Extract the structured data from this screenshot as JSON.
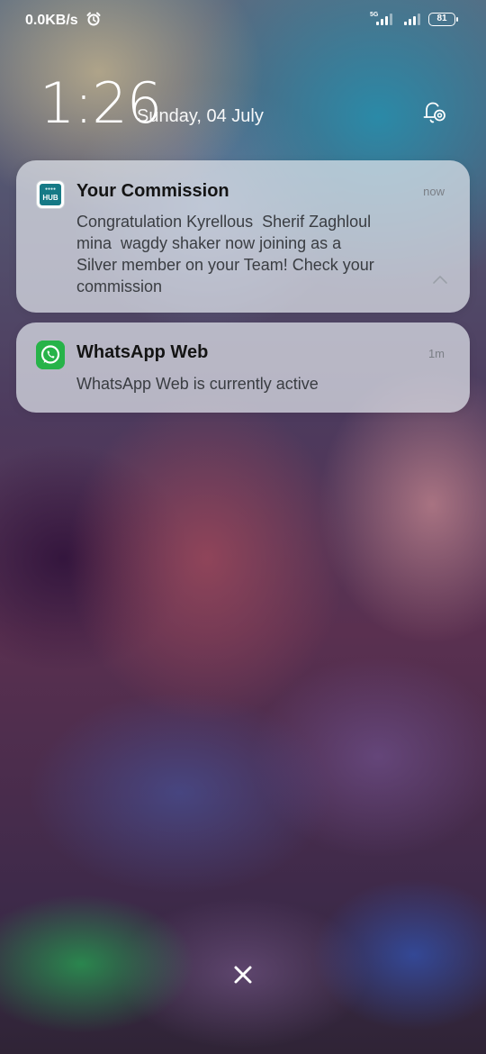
{
  "status_bar": {
    "net_speed": "0.0KB/s",
    "alarm_icon": "alarm-clock-icon",
    "network_type": "5G",
    "battery_level": "81"
  },
  "lockscreen": {
    "time": "1:26",
    "date": "Sunday, 04 July"
  },
  "notifications": [
    {
      "app_icon": "hub-app-icon",
      "title": "Your Commission",
      "time": "now",
      "body": "Congratulation Kyrellous  Sherif Zaghloul\nmina  wagdy shaker now joining as a\nSilver member on your Team! Check your\ncommission"
    },
    {
      "app_icon": "whatsapp-icon",
      "title": "WhatsApp Web",
      "time": "1m",
      "body": "WhatsApp Web is currently active"
    }
  ],
  "colors": {
    "card_background": "#e1e4eb",
    "whatsapp_green": "#27b349",
    "hub_teal": "#167a86"
  }
}
